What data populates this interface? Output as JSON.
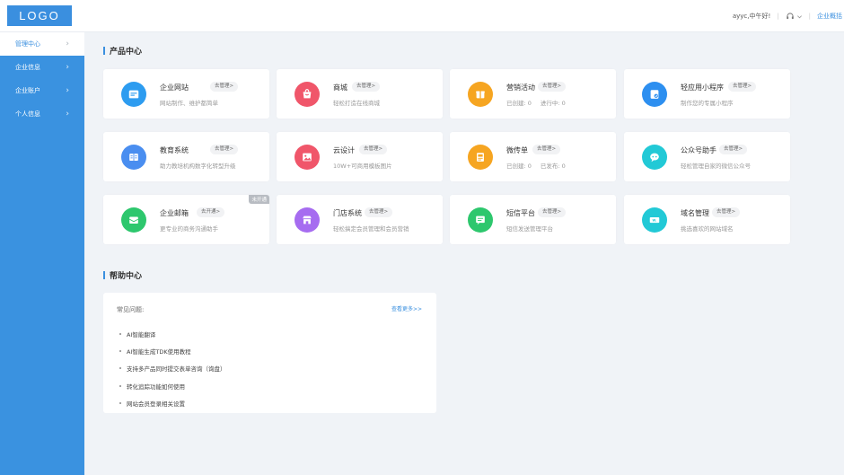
{
  "logo": "LOGO",
  "header": {
    "greeting": "ayyc,中午好!",
    "enterprise_link": "企业概括"
  },
  "sidebar": {
    "items": [
      {
        "label": "管理中心"
      },
      {
        "label": "企业信息"
      },
      {
        "label": "企业账户"
      },
      {
        "label": "个人信息"
      }
    ]
  },
  "products": {
    "title": "产品中心",
    "cards": [
      {
        "name": "企业网站",
        "button": "去管理>",
        "desc": "网站制作、维护都简单",
        "icon": "website-icon",
        "color": "#2d9cf0"
      },
      {
        "name": "商城",
        "button": "去管理>",
        "desc": "轻松打造在线商城",
        "icon": "mall-icon",
        "color": "#f0566a"
      },
      {
        "name": "营销活动",
        "button": "去管理>",
        "stat1_label": "已创建:",
        "stat1_value": "0",
        "stat2_label": "进行中:",
        "stat2_value": "0",
        "icon": "marketing-icon",
        "color": "#f6a521"
      },
      {
        "name": "轻应用小程序",
        "button": "去管理>",
        "desc": "制作您的专属小程序",
        "icon": "mini-program-icon",
        "color": "#2d8ff0"
      },
      {
        "name": "教育系统",
        "button": "去管理>",
        "desc": "助力教培机构数字化转型升级",
        "icon": "education-icon",
        "color": "#4a8ef0"
      },
      {
        "name": "云设计",
        "button": "去管理>",
        "desc": "10W+可商用模板图片",
        "icon": "cloud-design-icon",
        "color": "#f0566a"
      },
      {
        "name": "微传单",
        "button": "去管理>",
        "stat1_label": "已创建:",
        "stat1_value": "0",
        "stat2_label": "已发布:",
        "stat2_value": "0",
        "icon": "flyer-icon",
        "color": "#f6a521"
      },
      {
        "name": "公众号助手",
        "button": "去管理>",
        "desc": "轻松管理自家的微信公众号",
        "icon": "official-account-icon",
        "color": "#22c9d6"
      },
      {
        "name": "企业邮箱",
        "button": "去开通>",
        "desc": "更专业的商务沟通助手",
        "tag": "未开通",
        "icon": "mail-icon",
        "color": "#2dc76d"
      },
      {
        "name": "门店系统",
        "button": "去管理>",
        "desc": "轻松搞定会员管理和会员营销",
        "icon": "store-icon",
        "color": "#a66cf0"
      },
      {
        "name": "短信平台",
        "button": "去管理>",
        "desc": "短信发送管理平台",
        "icon": "sms-icon",
        "color": "#2dc76d"
      },
      {
        "name": "域名管理",
        "button": "去管理>",
        "desc": "挑选喜欢的网站域名",
        "icon": "domain-icon",
        "color": "#22c9d6"
      }
    ]
  },
  "help": {
    "title": "帮助中心",
    "faq_title": "常见问题:",
    "more": "查看更多>>",
    "items": [
      "AI智能翻译",
      "AI智能生成TDK使用教程",
      "支持多产品同时提交表单咨询（询盘）",
      "转化追踪功能如何使用",
      "网站会员登录相关设置"
    ]
  },
  "colors": {
    "accent": "#3a8fdf",
    "sidebar": "#3a92e0",
    "background": "#f0f3f7"
  }
}
